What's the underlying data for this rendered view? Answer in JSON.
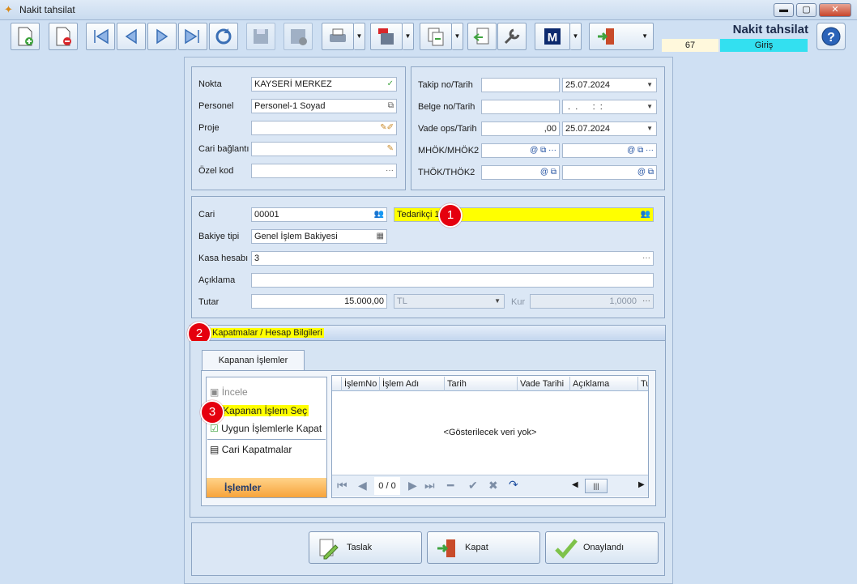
{
  "window": {
    "title": "Nakit tahsilat",
    "minimize": "▬",
    "maximize": "▢",
    "close": "✕"
  },
  "header": {
    "form_title": "Nakit tahsilat",
    "record_no": "67",
    "mode": "Giriş"
  },
  "left_group": {
    "nokta": {
      "label": "Nokta",
      "value": "KAYSERİ MERKEZ"
    },
    "personel": {
      "label": "Personel",
      "value": "Personel-1 Soyad"
    },
    "proje": {
      "label": "Proje",
      "value": ""
    },
    "cari_baglanti": {
      "label": "Cari bağlantı",
      "value": ""
    },
    "ozel_kod": {
      "label": "Özel kod",
      "value": ""
    }
  },
  "right_group": {
    "takip": {
      "label": "Takip no/Tarih",
      "no": "",
      "date": "25.07.2024"
    },
    "belge": {
      "label": "Belge no/Tarih",
      "no": "",
      "date": " .  .      :  :"
    },
    "vade": {
      "label": "Vade ops/Tarih",
      "value": ",00",
      "date": "25.07.2024"
    },
    "mhok": {
      "label": "MHÖK/MHÖK2"
    },
    "thok": {
      "label": "THÖK/THÖK2"
    }
  },
  "cari_group": {
    "cari": {
      "label": "Cari",
      "code": "00001",
      "name": "Tedarikçi 1"
    },
    "bakiye": {
      "label": "Bakiye tipi",
      "value": "Genel İşlem Bakiyesi"
    },
    "kasa": {
      "label": "Kasa hesabı",
      "value": "3"
    },
    "aciklama": {
      "label": "Açıklama",
      "value": ""
    },
    "tutar": {
      "label": "Tutar",
      "value": "15.000,00",
      "currency": "TL",
      "kur_label": "Kur",
      "kur": "1,0000"
    }
  },
  "kapatmalar": {
    "header": "Kapatmalar / Hesap Bilgileri",
    "tab": "Kapanan İşlemler",
    "nav_items": [
      "İncele",
      "Kapanan İşlem Seç",
      "Uygun İşlemlerle Kapat",
      "Cari Kapatmalar"
    ],
    "nav_footer": "İşlemler",
    "grid": {
      "columns": [
        "İşlemNo",
        "İşlem Adı",
        "Tarih",
        "Vade Tarihi",
        "Açıklama",
        "Tu"
      ],
      "empty_text": "<Gösterilecek veri yok>",
      "pager": "0 / 0"
    }
  },
  "buttons": {
    "taslak": "Taslak",
    "kapat": "Kapat",
    "onaylandi": "Onaylandı"
  },
  "markers": {
    "m1": "1",
    "m2": "2",
    "m3": "3"
  },
  "colors": {
    "highlight": "#ffff00",
    "mode_badge": "#33e0f0",
    "marker": "#e5000e"
  }
}
